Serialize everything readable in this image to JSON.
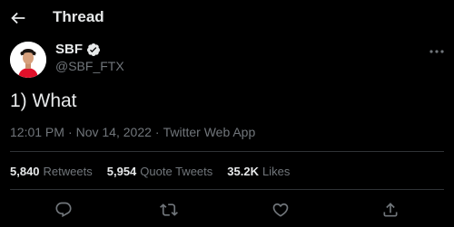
{
  "header": {
    "title": "Thread",
    "back_icon": "arrow-left-icon"
  },
  "author": {
    "name": "SBF",
    "handle": "@SBF_FTX",
    "verified": true,
    "verified_color": "#1d9bf0",
    "avatar_shirt_color": "#e0102a"
  },
  "tweet": {
    "text": "1) What",
    "time": "12:01 PM",
    "date": "Nov 14, 2022",
    "source": "Twitter Web App",
    "separator": "·"
  },
  "stats": {
    "retweets": {
      "count": "5,840",
      "label": "Retweets"
    },
    "quote_tweets": {
      "count": "5,954",
      "label": "Quote Tweets"
    },
    "likes": {
      "count": "35.2K",
      "label": "Likes"
    }
  },
  "actions": [
    "reply-icon",
    "retweet-icon",
    "like-icon",
    "share-icon"
  ],
  "colors": {
    "background": "#000000",
    "text": "#e7e9ea",
    "secondary": "#71767b",
    "divider": "#2f3336"
  }
}
